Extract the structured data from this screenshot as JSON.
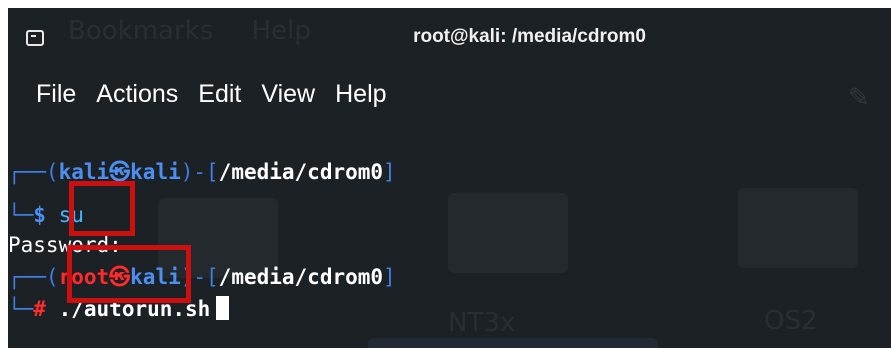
{
  "window": {
    "title": "root@kali: /media/cdrom0"
  },
  "menu": [
    "File",
    "Actions",
    "Edit",
    "View",
    "Help"
  ],
  "background_ghost": {
    "menu": [
      "Bookmarks",
      "Help"
    ],
    "labels": [
      "NT3x",
      "OS2"
    ]
  },
  "terminal": {
    "prompt1": {
      "corner": "┌──(",
      "user": "kali",
      "at": "㉿",
      "host": "kali",
      "mid": ")-[",
      "path": "/media/cdrom0",
      "close": "]"
    },
    "cmd1": {
      "corner": "└─",
      "sigil": "$",
      "command": "su"
    },
    "password_prompt": "Password:",
    "prompt2": {
      "corner": "┌──(",
      "user": "root",
      "at": "㉿",
      "host": "kali",
      "mid": ")-[",
      "path": "/media/cdrom0",
      "close": "]"
    },
    "cmd2": {
      "corner": "└─",
      "sigil": "#",
      "command": "./autorun.sh"
    }
  },
  "colors": {
    "background": "#1c2126",
    "prompt_blue": "#3f7de0",
    "root_red": "#ff2a2a",
    "command_cyan": "#40b8ff",
    "highlight_red": "#cc1010"
  }
}
